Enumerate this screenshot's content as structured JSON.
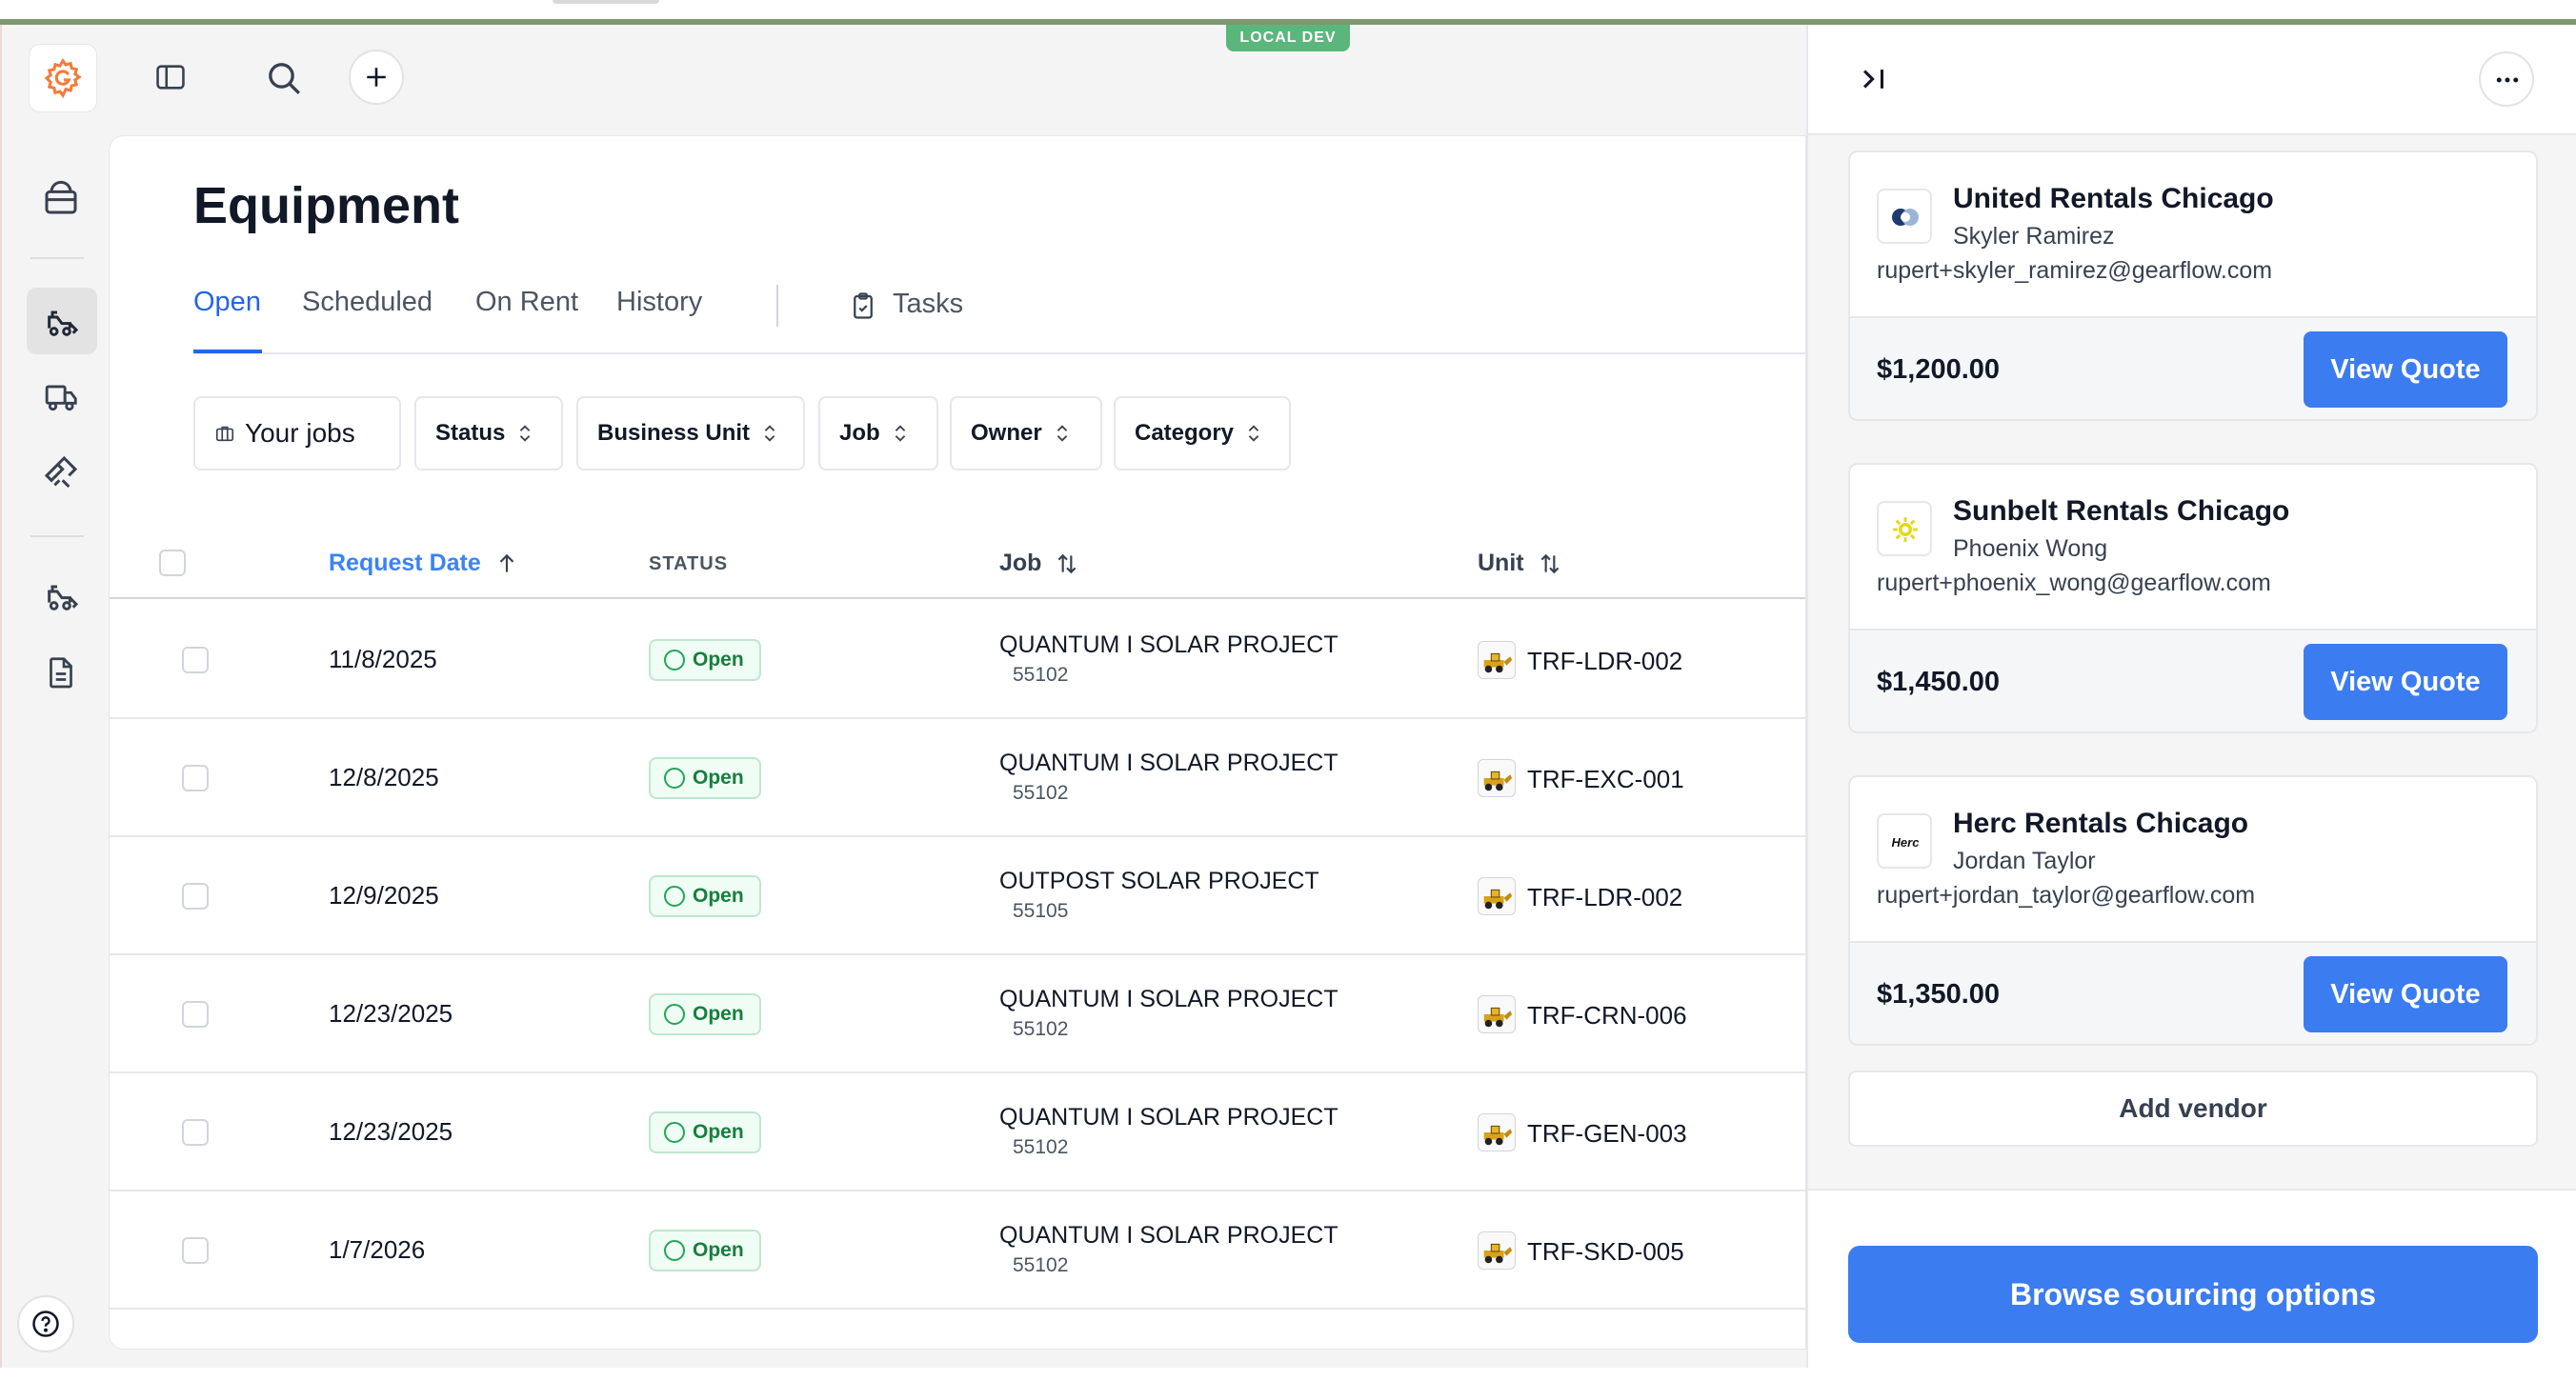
{
  "env_badge": "LOCAL DEV",
  "page": {
    "title": "Equipment",
    "tabs": [
      {
        "label": "Open",
        "active": true
      },
      {
        "label": "Scheduled",
        "active": false
      },
      {
        "label": "On Rent",
        "active": false
      },
      {
        "label": "History",
        "active": false
      }
    ],
    "tasks_label": "Tasks"
  },
  "filters": [
    "Your jobs",
    "Status",
    "Business Unit",
    "Job",
    "Owner",
    "Category"
  ],
  "table": {
    "columns": {
      "request_date": "Request Date",
      "status": "STATUS",
      "job": "Job",
      "unit": "Unit"
    },
    "rows": [
      {
        "date": "11/8/2025",
        "status": "Open",
        "job": "QUANTUM I SOLAR PROJECT",
        "job_no": "55102",
        "unit": "TRF-LDR-002"
      },
      {
        "date": "12/8/2025",
        "status": "Open",
        "job": "QUANTUM I SOLAR PROJECT",
        "job_no": "55102",
        "unit": "TRF-EXC-001"
      },
      {
        "date": "12/9/2025",
        "status": "Open",
        "job": "OUTPOST SOLAR PROJECT",
        "job_no": "55105",
        "unit": "TRF-LDR-002"
      },
      {
        "date": "12/23/2025",
        "status": "Open",
        "job": "QUANTUM I SOLAR PROJECT",
        "job_no": "55102",
        "unit": "TRF-CRN-006"
      },
      {
        "date": "12/23/2025",
        "status": "Open",
        "job": "QUANTUM I SOLAR PROJECT",
        "job_no": "55102",
        "unit": "TRF-GEN-003"
      },
      {
        "date": "1/7/2026",
        "status": "Open",
        "job": "QUANTUM I SOLAR PROJECT",
        "job_no": "55102",
        "unit": "TRF-SKD-005"
      }
    ]
  },
  "panel": {
    "vendors": [
      {
        "name": "United Rentals Chicago",
        "contact": "Skyler Ramirez",
        "email": "rupert+skyler_ramirez@gearflow.com",
        "price": "$1,200.00",
        "button": "View Quote"
      },
      {
        "name": "Sunbelt Rentals Chicago",
        "contact": "Phoenix Wong",
        "email": "rupert+phoenix_wong@gearflow.com",
        "price": "$1,450.00",
        "button": "View Quote"
      },
      {
        "name": "Herc Rentals Chicago",
        "contact": "Jordan Taylor",
        "email": "rupert+jordan_taylor@gearflow.com",
        "price": "$1,350.00",
        "button": "View Quote",
        "logo_text": "Herc"
      }
    ],
    "add_vendor": "Add vendor",
    "browse": "Browse sourcing options"
  },
  "colors": {
    "accent": "#3b7cf0",
    "status_green": "#15803d",
    "env_badge": "#5bb67b"
  },
  "icons": [
    "gearflow-logo-icon",
    "sidebar-toggle-icon",
    "search-icon",
    "plus-icon",
    "inventory-icon",
    "loader-icon",
    "truck-icon",
    "tools-icon",
    "equipment-icon",
    "document-icon",
    "help-icon",
    "collapse-panel-icon",
    "more-icon",
    "clipboard-icon",
    "briefcase-icon",
    "sort-icon"
  ]
}
